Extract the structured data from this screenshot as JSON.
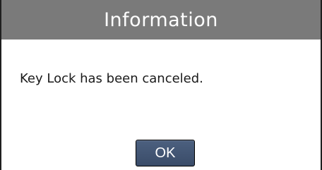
{
  "dialog": {
    "title": "Information",
    "message": "Key Lock has been canceled.",
    "ok_label": "OK"
  },
  "colors": {
    "title_bar": "#7a7a7a",
    "title_text": "#ffffff",
    "button_fill": "#43567a",
    "border": "#1f1f1f"
  }
}
